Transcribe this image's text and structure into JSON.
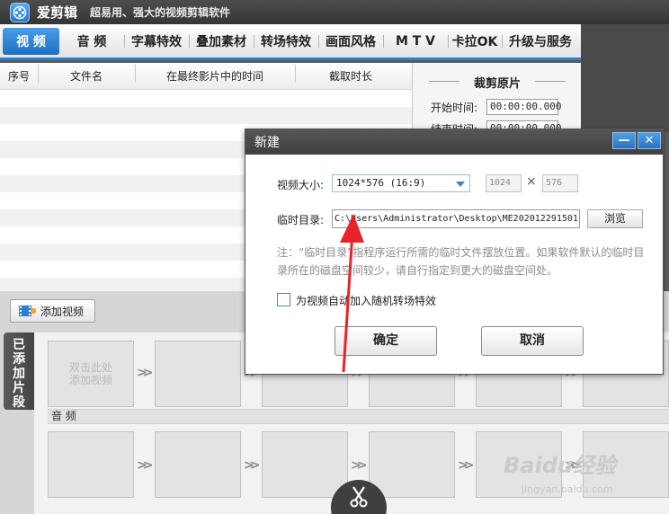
{
  "app": {
    "name": "爱剪辑",
    "slogan": "超易用、强大的视频剪辑软件"
  },
  "menu": [
    {
      "label": "视 频",
      "active": true
    },
    {
      "label": "音 频"
    },
    {
      "label": "字幕特效"
    },
    {
      "label": "叠加素材"
    },
    {
      "label": "转场特效"
    },
    {
      "label": "画面风格"
    },
    {
      "label": "M T V"
    },
    {
      "label": "卡拉OK"
    },
    {
      "label": "升级与服务"
    }
  ],
  "table": {
    "columns": [
      "序号",
      "文件名",
      "在最终影片中的时间",
      "截取时长"
    ]
  },
  "crop": {
    "title": "裁剪原片",
    "start_label": "开始时间:",
    "start_value": "00:00:00.000",
    "end_label": "结束时间:",
    "end_value": "00:00:00.000"
  },
  "bottom": {
    "add_video_label": "添加视频",
    "side_tab_label": "已添加片段",
    "clip_placeholder": "双击此处\n添加视频",
    "audio_label": "音 频"
  },
  "dialog": {
    "title": "新建",
    "size_label": "视频大小:",
    "size_value": "1024*576 (16:9)",
    "width_value": "1024",
    "height_value": "576",
    "times_symbol": "×",
    "temp_label": "临时目录:",
    "temp_path": "C:\\Users\\Administrator\\Desktop\\ME202012291501",
    "browse_label": "浏览",
    "note": "注：“临时目录”指程序运行所需的临时文件摆放位置。如果软件默认的临时目录所在的磁盘空间较少，请自行指定到更大的磁盘空间处。",
    "checkbox_label": "为视频自动加入随机转场特效",
    "checkbox_checked": false,
    "ok_label": "确定",
    "cancel_label": "取消",
    "minimize_symbol": "—",
    "close_symbol": "✕"
  },
  "watermark": {
    "main": "Baidu经验",
    "sub": "jingyan.baidu.com"
  },
  "colors": {
    "accent": "#2f7fd0",
    "annotation": "#e8232a"
  }
}
